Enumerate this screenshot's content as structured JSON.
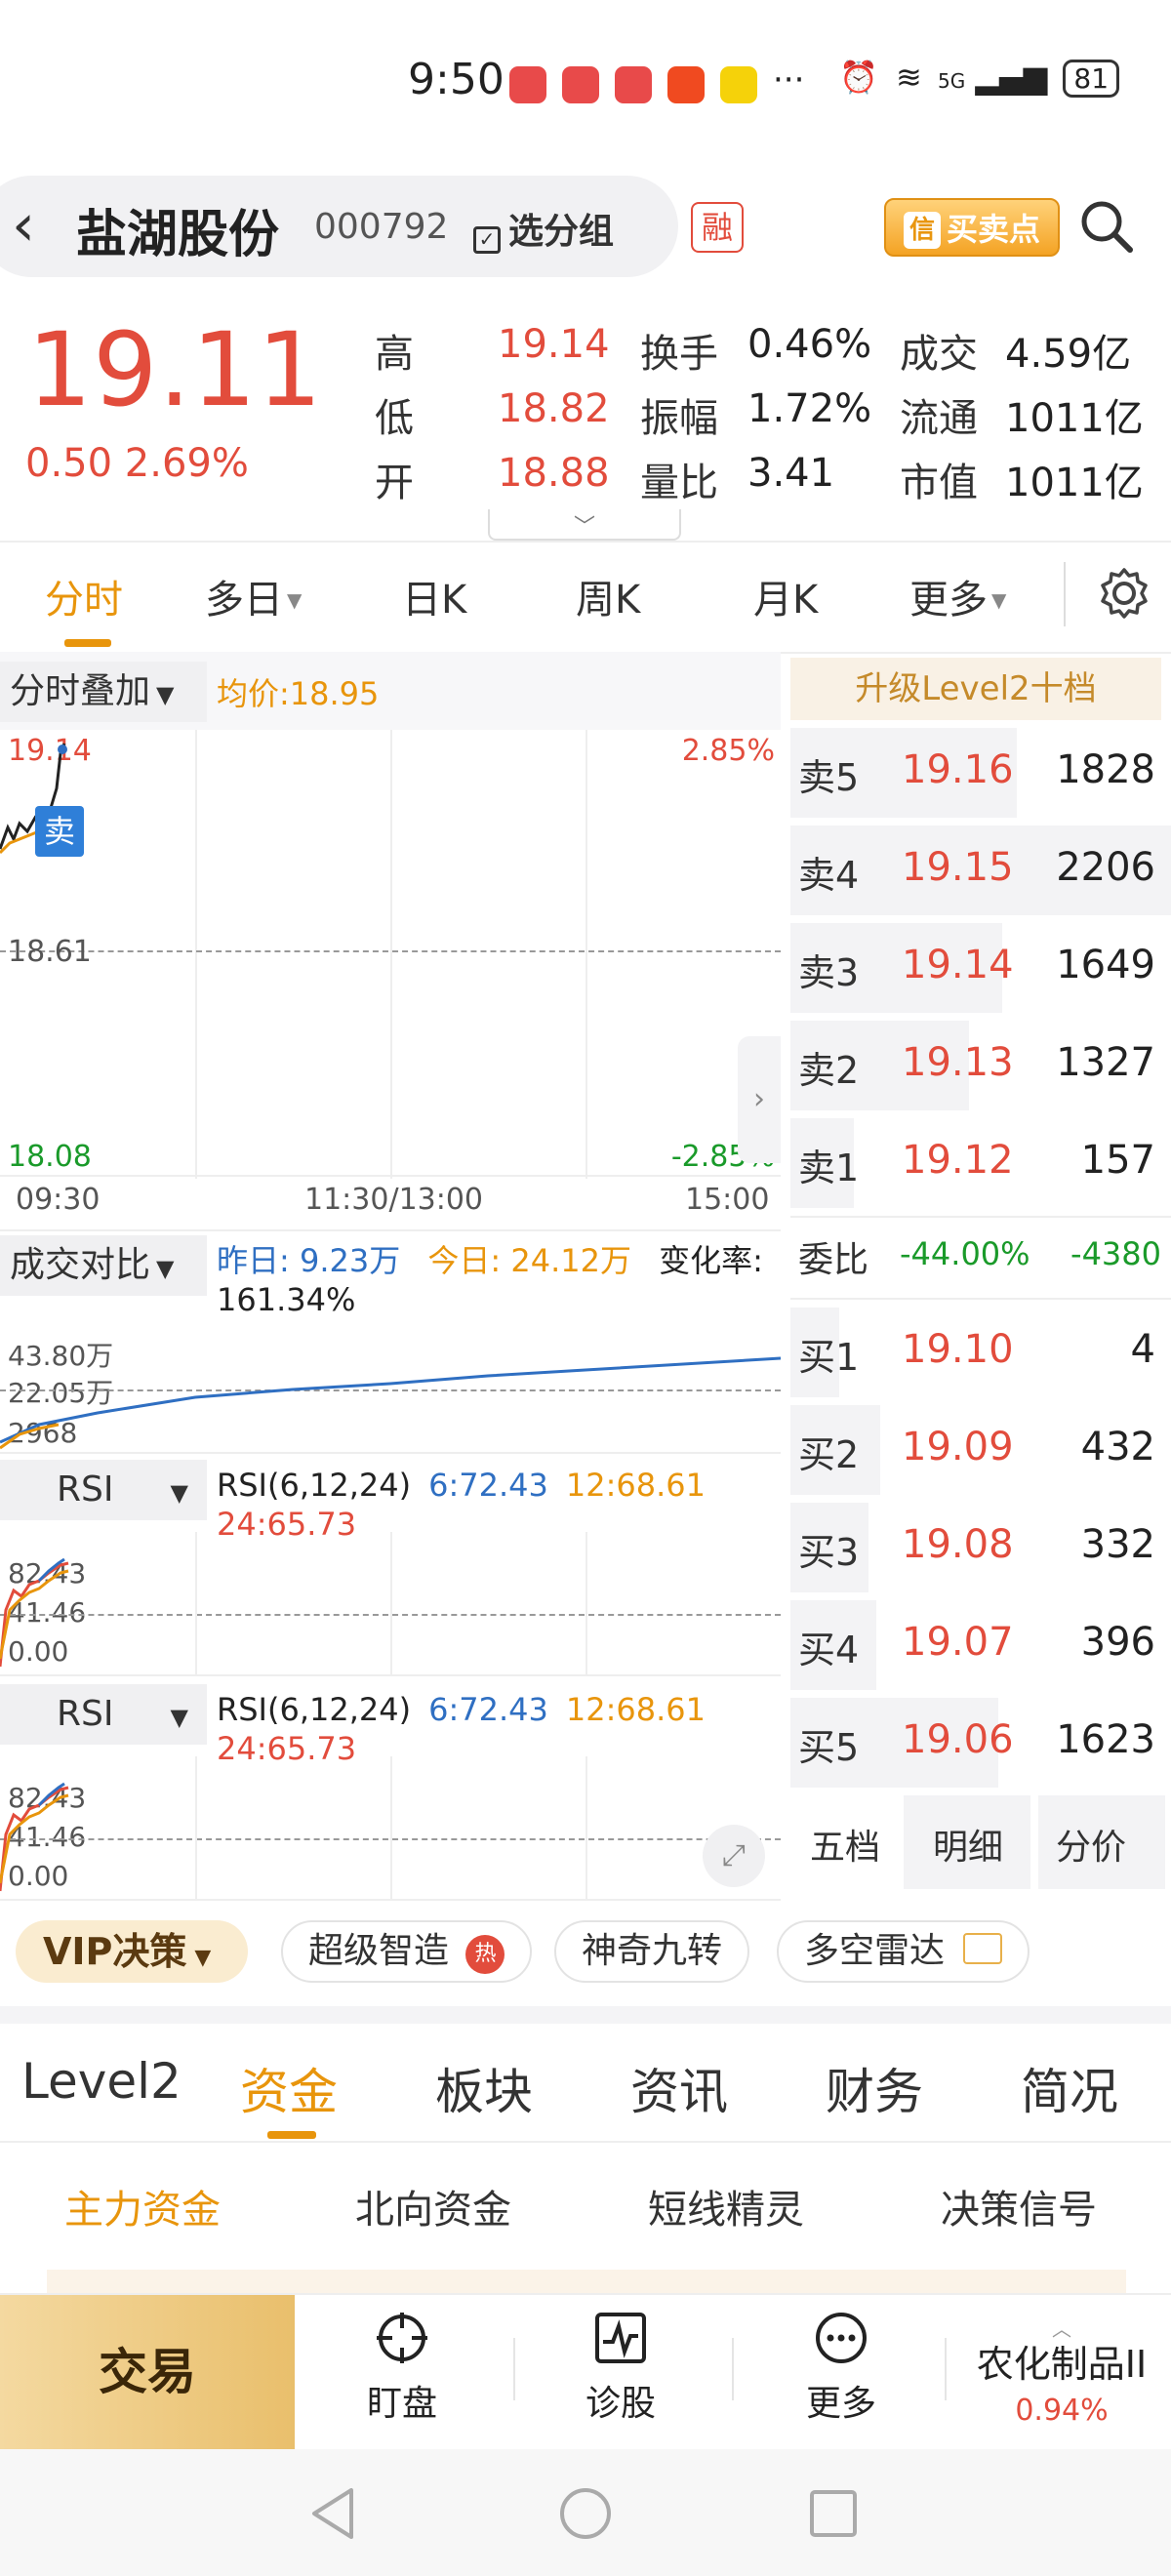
{
  "status_bar": {
    "time": "9:50",
    "network": "5G",
    "battery": "81"
  },
  "header": {
    "stock_name": "盐湖股份",
    "stock_code": "000792",
    "group_btn": "选分组",
    "margin_tag": "融",
    "buy_sell_btn": "买卖点",
    "buy_sell_icon_char": "信"
  },
  "quote": {
    "price": "19.11",
    "change": "0.50",
    "change_pct": "2.69%",
    "stats": [
      {
        "label": "高",
        "value": "19.14",
        "color": "red"
      },
      {
        "label": "换手",
        "value": "0.46%",
        "color": ""
      },
      {
        "label": "成交",
        "value": "4.59亿",
        "color": ""
      },
      {
        "label": "低",
        "value": "18.82",
        "color": "red"
      },
      {
        "label": "振幅",
        "value": "1.72%",
        "color": ""
      },
      {
        "label": "流通",
        "value": "1011亿",
        "color": ""
      },
      {
        "label": "开",
        "value": "18.88",
        "color": "red"
      },
      {
        "label": "量比",
        "value": "3.41",
        "color": ""
      },
      {
        "label": "市值",
        "value": "1011亿",
        "color": ""
      }
    ]
  },
  "chart_tabs": [
    "分时",
    "多日",
    "日K",
    "周K",
    "月K",
    "更多"
  ],
  "intraday": {
    "overlay_btn": "分时叠加",
    "avg_label": "均价:18.95",
    "top_price": "19.14",
    "mid_price": "18.61",
    "bottom_price": "18.08",
    "top_pct": "2.85%",
    "bottom_pct": "-2.85%",
    "time_start": "09:30",
    "time_mid": "11:30/13:00",
    "time_end": "15:00",
    "sell_marker": "卖"
  },
  "volume_compare": {
    "btn": "成交对比",
    "yesterday": "昨日: 9.23万",
    "today": "今日: 24.12万",
    "change_label": "变化率:",
    "change_value": "161.34%",
    "y_top": "43.80万",
    "y_mid": "22.05万",
    "y_bottom": "2968"
  },
  "rsi_panels": [
    {
      "btn": "RSI",
      "params": "RSI(6,12,24)",
      "rsi6": "6:72.43",
      "rsi12": "12:68.61",
      "rsi24": "24:65.73",
      "y_top": "82.43",
      "y_mid": "41.46",
      "y_bottom": "0.00"
    },
    {
      "btn": "RSI",
      "params": "RSI(6,12,24)",
      "rsi6": "6:72.43",
      "rsi12": "12:68.61",
      "rsi24": "24:65.73",
      "y_top": "82.43",
      "y_mid": "41.46",
      "y_bottom": "0.00"
    }
  ],
  "order_book": {
    "upgrade": "升级Level2十档",
    "sells": [
      {
        "label": "卖5",
        "price": "19.16",
        "vol": "1828",
        "depth": 0.48
      },
      {
        "label": "卖4",
        "price": "19.15",
        "vol": "2206",
        "depth": 1.0
      },
      {
        "label": "卖3",
        "price": "19.14",
        "vol": "1649",
        "depth": 0.44
      },
      {
        "label": "卖2",
        "price": "19.13",
        "vol": "1327",
        "depth": 0.35
      },
      {
        "label": "卖1",
        "price": "19.12",
        "vol": "157",
        "depth": 0.04
      }
    ],
    "ratio_label": "委比",
    "ratio_pct": "-44.00%",
    "ratio_val": "-4380",
    "buys": [
      {
        "label": "买1",
        "price": "19.10",
        "vol": "4",
        "depth": 0.0
      },
      {
        "label": "买2",
        "price": "19.09",
        "vol": "432",
        "depth": 0.11
      },
      {
        "label": "买3",
        "price": "19.08",
        "vol": "332",
        "depth": 0.08
      },
      {
        "label": "买4",
        "price": "19.07",
        "vol": "396",
        "depth": 0.1
      },
      {
        "label": "买5",
        "price": "19.06",
        "vol": "1623",
        "depth": 0.43
      }
    ],
    "tabs": [
      "五档",
      "明细",
      "分价"
    ]
  },
  "features": {
    "vip": "VIP决策",
    "items": [
      "超级智造",
      "神奇九转",
      "多空雷达"
    ],
    "hot_badge": "热"
  },
  "section_tabs": [
    "Level2",
    "资金",
    "板块",
    "资讯",
    "财务",
    "简况"
  ],
  "sub_tabs": [
    "主力资金",
    "北向资金",
    "短线精灵",
    "决策信号"
  ],
  "bottom_nav": {
    "trade": "交易",
    "items": [
      "盯盘",
      "诊股",
      "更多"
    ],
    "sector_name": "农化制品II",
    "sector_pct": "0.94%"
  }
}
